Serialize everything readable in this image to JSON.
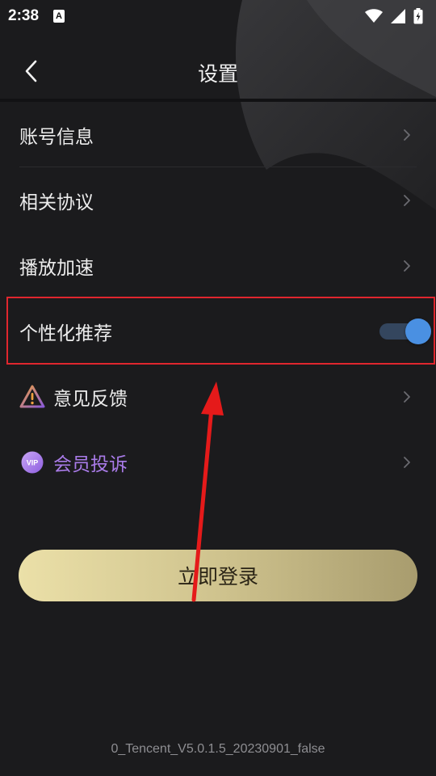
{
  "status_bar": {
    "time": "2:38",
    "notification_letter": "A"
  },
  "nav": {
    "title": "设置"
  },
  "settings": {
    "account_info": "账号信息",
    "agreements": "相关协议",
    "playback_speedup": "播放加速",
    "personalized_recommendation": "个性化推荐",
    "personalized_recommendation_enabled": true,
    "feedback": "意见反馈",
    "vip_complaint": "会员投诉",
    "vip_badge": "VIP"
  },
  "login": {
    "label": "立即登录"
  },
  "footer": {
    "version": "0_Tencent_V5.0.1.5_20230901_false"
  },
  "colors": {
    "background": "#1b1b1d",
    "accent_toggle": "#4a90e2",
    "vip_text": "#a97be8",
    "login_gold_start": "#ebe0a8",
    "login_gold_end": "#a89c6e",
    "highlight_red": "#e0262e"
  },
  "icons": {
    "back": "chevron-left-icon",
    "row_chevron": "chevron-right-icon",
    "feedback": "warning-triangle-icon",
    "vip": "vip-badge-icon",
    "wifi": "wifi-icon",
    "signal": "signal-icon",
    "battery": "battery-icon"
  }
}
